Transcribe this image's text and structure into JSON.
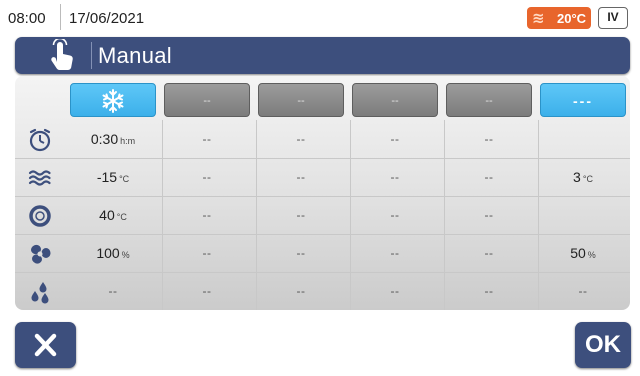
{
  "status_bar": {
    "time": "08:00",
    "date": "17/06/2021",
    "temperature": "20°C",
    "temperature_badge_color": "#e8652c",
    "level_badge": "IV"
  },
  "header": {
    "mode_icon": "hand-touch-icon",
    "title": "Manual",
    "color": "#3d4f7d"
  },
  "phases": [
    {
      "label": "",
      "icon": "snowflake-icon",
      "state": "active"
    },
    {
      "label": "--",
      "state": "inactive"
    },
    {
      "label": "--",
      "state": "inactive"
    },
    {
      "label": "--",
      "state": "inactive"
    },
    {
      "label": "--",
      "state": "inactive"
    },
    {
      "label": "---",
      "state": "active"
    }
  ],
  "rows": [
    {
      "icon": "timer-icon",
      "cells": [
        {
          "value": "0:30",
          "unit": "h:m"
        },
        {
          "value": "--"
        },
        {
          "value": "--"
        },
        {
          "value": "--"
        },
        {
          "value": "--"
        },
        {
          "value": ""
        }
      ]
    },
    {
      "icon": "air-temperature-icon",
      "cells": [
        {
          "value": "-15",
          "unit": "°C"
        },
        {
          "value": "--"
        },
        {
          "value": "--"
        },
        {
          "value": "--"
        },
        {
          "value": "--"
        },
        {
          "value": "3",
          "unit": "°C"
        }
      ]
    },
    {
      "icon": "core-probe-icon",
      "cells": [
        {
          "value": "40",
          "unit": "°C"
        },
        {
          "value": "--"
        },
        {
          "value": "--"
        },
        {
          "value": "--"
        },
        {
          "value": "--"
        },
        {
          "value": ""
        }
      ]
    },
    {
      "icon": "fan-icon",
      "cells": [
        {
          "value": "100",
          "unit": "%"
        },
        {
          "value": "--"
        },
        {
          "value": "--"
        },
        {
          "value": "--"
        },
        {
          "value": "--"
        },
        {
          "value": "50",
          "unit": "%"
        }
      ]
    },
    {
      "icon": "humidity-icon",
      "cells": [
        {
          "value": "--"
        },
        {
          "value": "--"
        },
        {
          "value": "--"
        },
        {
          "value": "--"
        },
        {
          "value": "--"
        },
        {
          "value": "--"
        }
      ]
    }
  ],
  "footer": {
    "cancel_icon": "close-icon",
    "ok_label": "OK"
  },
  "colors": {
    "accent_blue": "#3cb0ea",
    "navy": "#3d4f7d",
    "inactive_gray": "#8a8a8a"
  }
}
